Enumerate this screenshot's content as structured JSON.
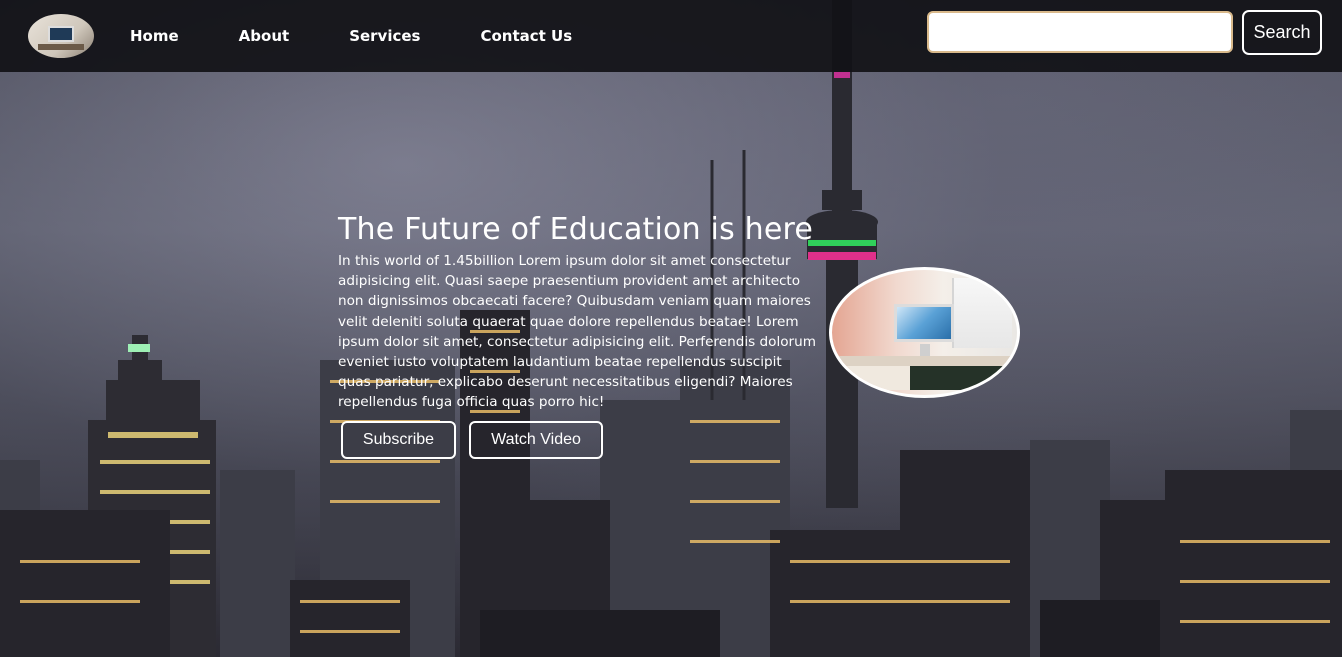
{
  "nav": {
    "links": [
      "Home",
      "About",
      "Services",
      "Contact Us"
    ],
    "search": {
      "value": "",
      "placeholder": ""
    },
    "search_button": "Search"
  },
  "hero": {
    "title": "The Future of Education is here",
    "text": "In this world of 1.45billion Lorem ipsum dolor sit amet consectetur adipisicing elit. Quasi saepe praesentium provident amet architecto non dignissimos obcaecati facere? Quibusdam veniam quam maiores velit deleniti soluta quaerat quae dolore repellendus beatae! Lorem ipsum dolor sit amet, consectetur adipisicing elit. Perferendis dolorum eveniet iusto voluptatem laudantium beatae repellendus suscipit quas pariatur, explicabo deserunt necessitatibus eligendi? Maiores repellendus fuga officia quas porro hic!",
    "subscribe_button": "Subscribe",
    "watch_button": "Watch Video"
  }
}
